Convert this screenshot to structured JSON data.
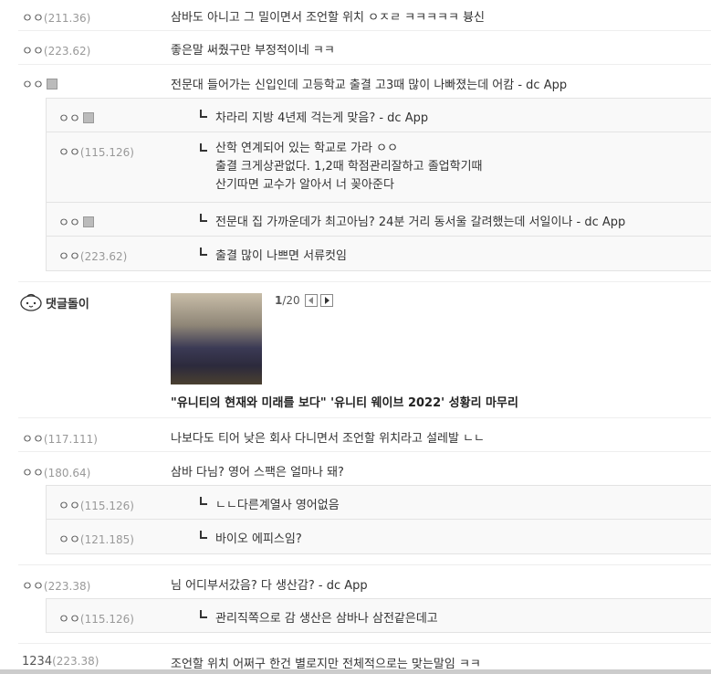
{
  "comments": [
    {
      "nick": "ㅇㅇ",
      "ip": "(211.36)",
      "text": "삼바도 아니고 그 밀이면서 조언할 위치 ㅇㅈㄹ ㅋㅋㅋㅋㅋ 븅신"
    },
    {
      "nick": "ㅇㅇ",
      "ip": "(223.62)",
      "text": "좋은말 써줬구만 부정적이네 ㅋㅋ"
    },
    {
      "nick": "ㅇㅇ",
      "ip": "",
      "text": "전문대 들어가는 신입인데 고등학교 출결 고3때 많이 나빠졌는데 어캄 - dc App"
    },
    {
      "nick": "ㅇㅇ",
      "ip": "(117.111)",
      "text": "나보다도 티어 낮은 회사 다니면서 조언할 위치라고 설레발 ㄴㄴ"
    },
    {
      "nick": "ㅇㅇ",
      "ip": "(180.64)",
      "text": "삼바 다님? 영어 스팩은 얼마나 돼?"
    },
    {
      "nick": "ㅇㅇ",
      "ip": "(223.38)",
      "text": "님 어디부서갔음? 다 생산감? - dc App"
    },
    {
      "nick": "1234",
      "ip": "(223.38)",
      "text": "조언할 위치 어쩌구 한건 별로지만 전체적으로는 맞는말임 ㅋㅋ"
    }
  ],
  "replies_group1": [
    {
      "nick": "ㅇㅇ",
      "ip": "",
      "text": "차라리 지방 4년제 걱는게 맞음? - dc App"
    },
    {
      "nick": "ㅇㅇ",
      "ip": "(115.126)",
      "lines": [
        "산학 연계되어 있는 학교로 가라 ㅇㅇ",
        "출결 크게상관없다. 1,2때 학점관리잘하고 졸업학기때",
        "산기따면 교수가 알아서 너 꽂아준다"
      ]
    },
    {
      "nick": "ㅇㅇ",
      "ip": "",
      "text": "전문대 집 가까운데가 최고아님? 24분 거리 동서울 갈려했는데 서일이나 - dc App"
    },
    {
      "nick": "ㅇㅇ",
      "ip": "(223.62)",
      "text": "출결 많이 나쁘면 서류컷임"
    }
  ],
  "replies_group2": [
    {
      "nick": "ㅇㅇ",
      "ip": "(115.126)",
      "text": "ㄴㄴ다른계열사 영어없음"
    },
    {
      "nick": "ㅇㅇ",
      "ip": "(121.185)",
      "text": "바이오 에피스임?"
    }
  ],
  "replies_group3": [
    {
      "nick": "ㅇㅇ",
      "ip": "(115.126)",
      "text": "관리직쪽으로 감 생산은 삼바나 삼전같은데고"
    }
  ],
  "bot": {
    "label": "댓글돌이",
    "page_current": "1",
    "page_total": "/20",
    "title": "\"유니티의 현재와 미래를 보다\" '유니티 웨이브 2022' 성황리 마무리"
  }
}
